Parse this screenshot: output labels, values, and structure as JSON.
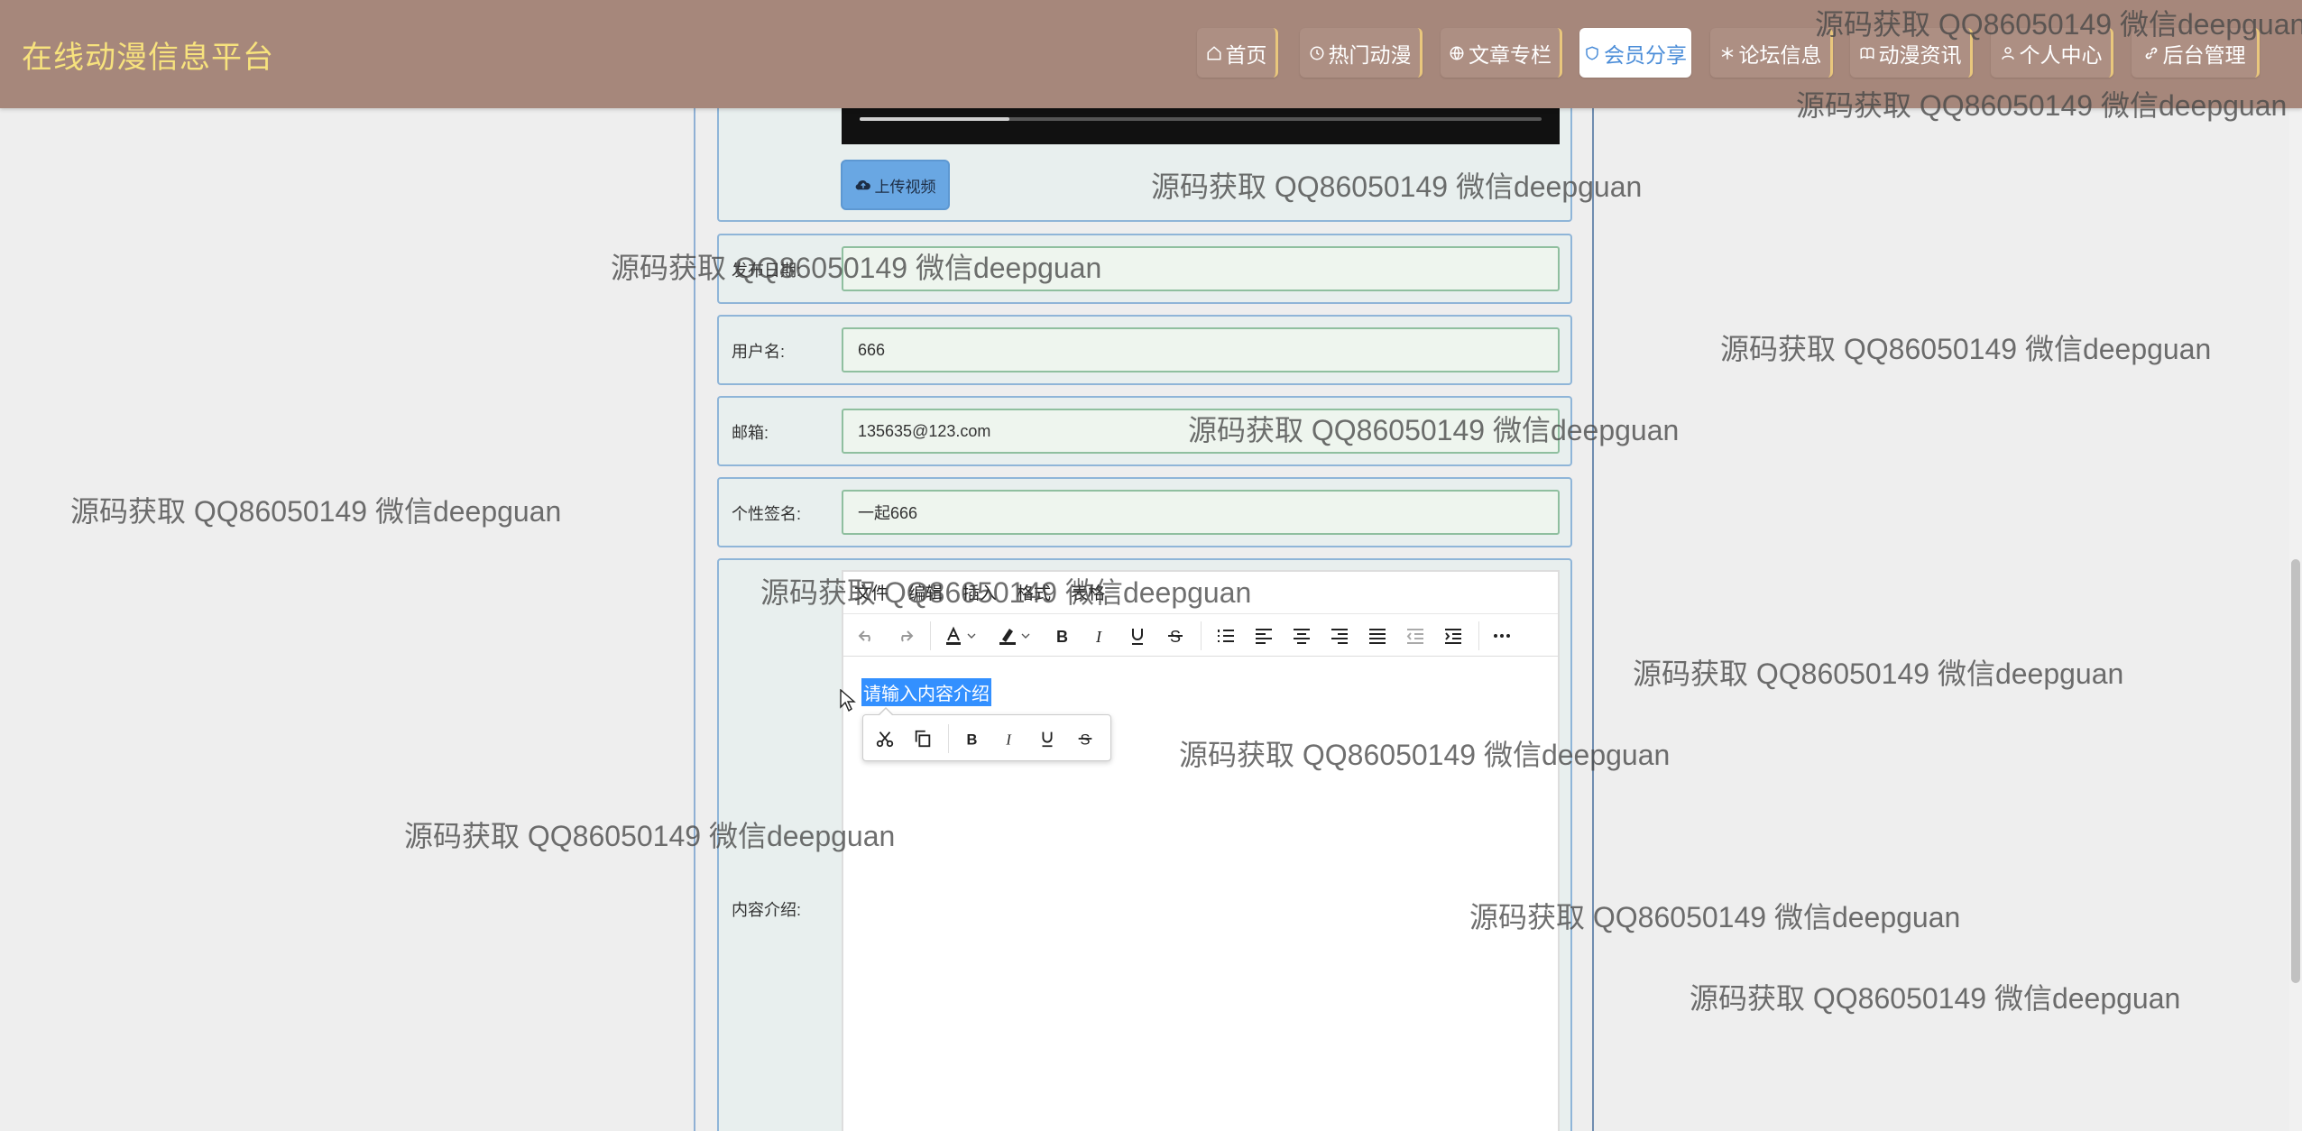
{
  "site": {
    "title": "在线动漫信息平台"
  },
  "nav": {
    "items": [
      {
        "label": "首页",
        "icon": "home-icon"
      },
      {
        "label": "热门动漫",
        "icon": "clock-icon"
      },
      {
        "label": "文章专栏",
        "icon": "globe-icon"
      },
      {
        "label": "会员分享",
        "icon": "shield-icon",
        "active": true
      },
      {
        "label": "论坛信息",
        "icon": "snowflake-icon"
      },
      {
        "label": "动漫资讯",
        "icon": "book-icon"
      },
      {
        "label": "个人中心",
        "icon": "user-icon"
      },
      {
        "label": "后台管理",
        "icon": "link-icon"
      }
    ]
  },
  "form": {
    "upload_video_label": "上传视频",
    "video_progress": 0.22,
    "publish_date": {
      "label": "发布日期:",
      "value": ""
    },
    "username": {
      "label": "用户名:",
      "value": "666"
    },
    "email": {
      "label": "邮箱:",
      "value": "135635@123.com"
    },
    "signature": {
      "label": "个性签名:",
      "value": "一起666"
    },
    "content": {
      "label": "内容介绍:",
      "placeholder_selected": "请输入内容介绍",
      "menu": [
        "文件",
        "编辑",
        "插入",
        "格式",
        "表格"
      ]
    }
  },
  "watermark": {
    "text": "源码获取 QQ86050149 微信deepguan"
  },
  "colors": {
    "header_bg": "#a6877b",
    "title_color": "#f7e27d",
    "active_nav_text": "#4b8dd8",
    "upload_button": "#69a7e3",
    "selection": "#3390ff"
  }
}
